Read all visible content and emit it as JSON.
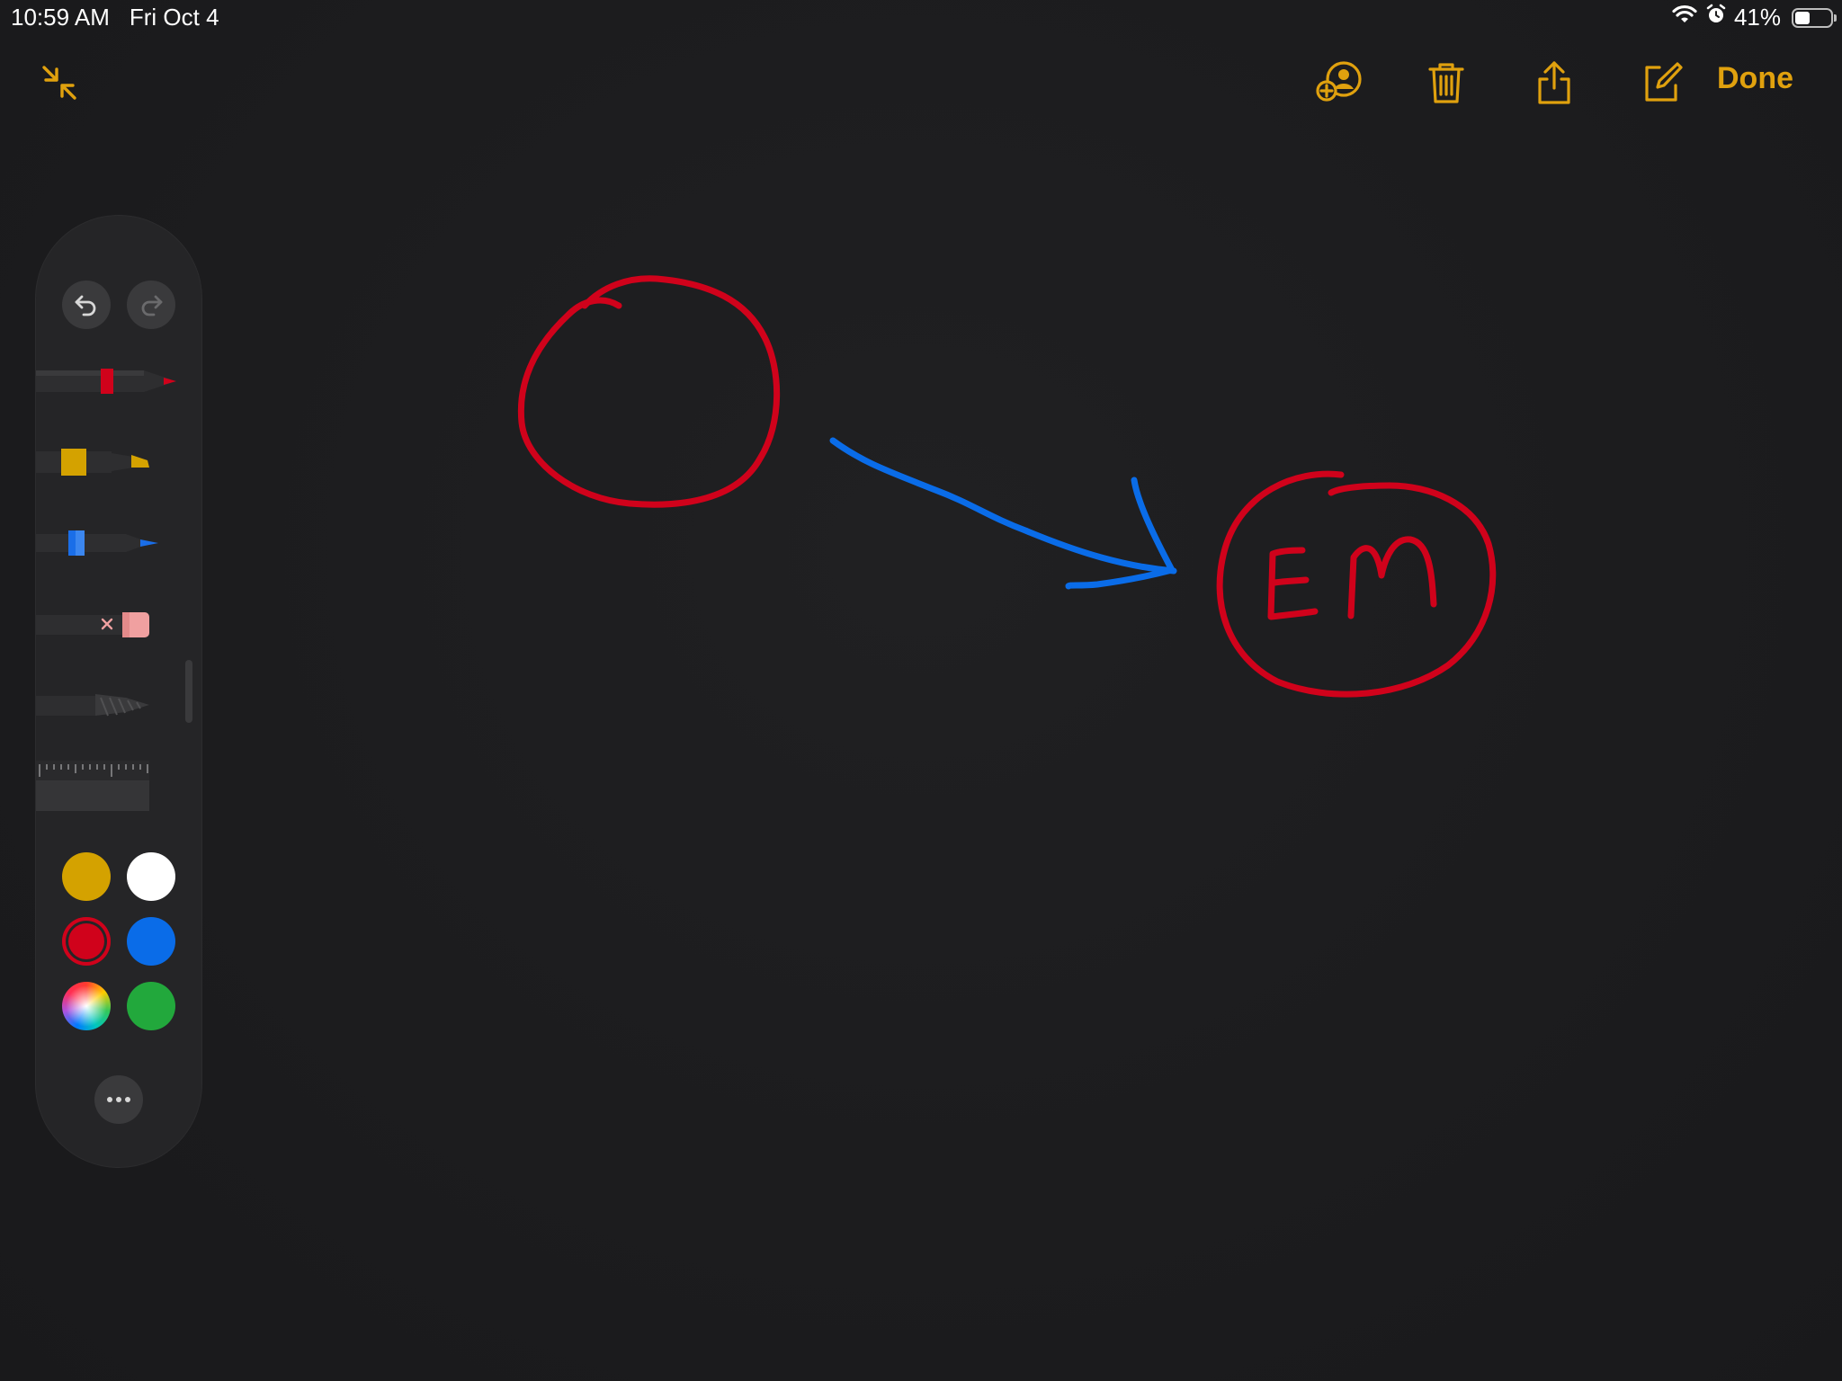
{
  "status_bar": {
    "time": "10:59 AM",
    "date": "Fri Oct 4",
    "battery_text": "41%",
    "battery_level": 0.41,
    "icons": [
      "wifi-icon",
      "alarm-icon",
      "battery-icon"
    ]
  },
  "toolbar": {
    "collapse_icon": "collapse-arrows-icon",
    "add_person_icon": "add-person-icon",
    "trash_icon": "trash-icon",
    "share_icon": "share-icon",
    "compose_icon": "compose-icon",
    "done_label": "Done",
    "accent_color": "#e0a10e"
  },
  "palette": {
    "undo_icon": "undo-icon",
    "redo_icon": "redo-icon",
    "tools": [
      {
        "name": "pen",
        "color": "#d0021b"
      },
      {
        "name": "marker",
        "color": "#d4a200"
      },
      {
        "name": "pencil",
        "color": "#1a6ee8"
      },
      {
        "name": "eraser",
        "color": "#f0a0a0"
      },
      {
        "name": "lasso",
        "color": "#5a5a5a"
      },
      {
        "name": "ruler",
        "color": "#3a3a3c"
      }
    ],
    "swatches": [
      {
        "name": "yellow",
        "color": "#d4a200",
        "selected": false
      },
      {
        "name": "white",
        "color": "#ffffff",
        "selected": false
      },
      {
        "name": "red",
        "color": "#d0021b",
        "selected": true
      },
      {
        "name": "blue",
        "color": "#0a6ce8",
        "selected": false
      },
      {
        "name": "color-picker",
        "color": "multicolor",
        "selected": false
      },
      {
        "name": "green",
        "color": "#22a83c",
        "selected": false
      }
    ],
    "more_icon": "more-icon"
  },
  "drawing": {
    "handwritten_text": "EM",
    "stroke_colors": {
      "red": "#d0021b",
      "blue": "#0a6ce8"
    }
  }
}
